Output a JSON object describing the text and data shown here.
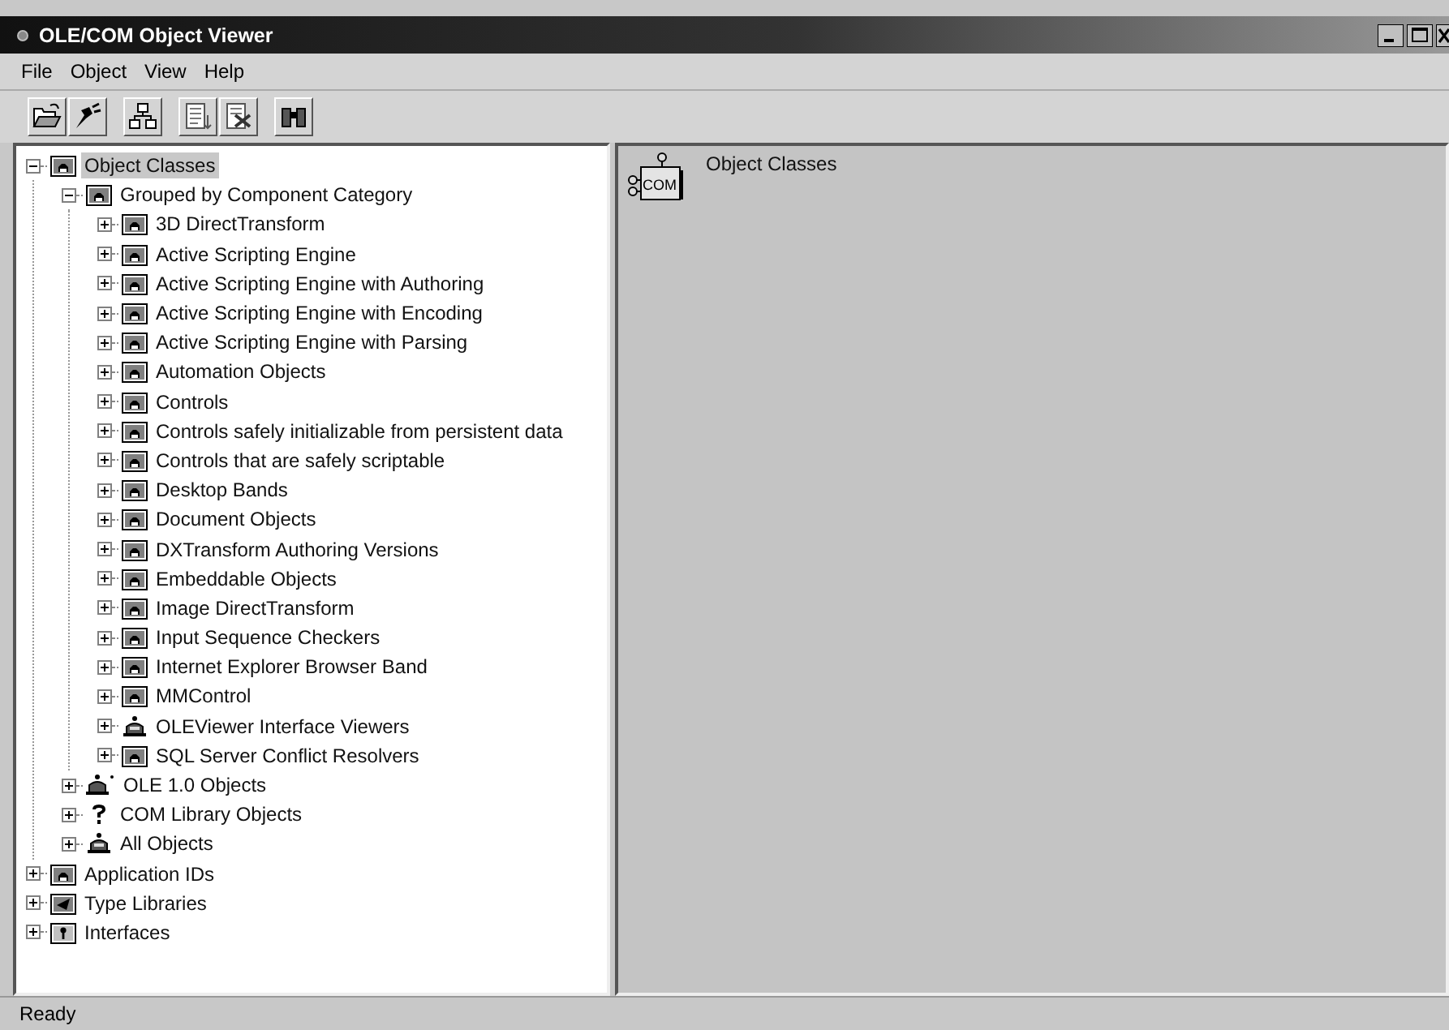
{
  "window": {
    "title": "OLE/COM Object Viewer"
  },
  "menu": [
    "File",
    "Object",
    "View",
    "Help"
  ],
  "tree": [
    {
      "label": "Object Classes",
      "kind": "folder",
      "expanded": true,
      "selected": true,
      "children": [
        {
          "label": "Grouped by Component Category",
          "kind": "folder",
          "expanded": true,
          "selected": false,
          "children": [
            {
              "label": "3D DirectTransform",
              "kind": "folder",
              "expanded": false,
              "selected": false
            },
            {
              "label": "Active Scripting Engine",
              "kind": "folder",
              "expanded": false,
              "selected": false
            },
            {
              "label": "Active Scripting Engine with Authoring",
              "kind": "folder",
              "expanded": false,
              "selected": false
            },
            {
              "label": "Active Scripting Engine with Encoding",
              "kind": "folder",
              "expanded": false,
              "selected": false
            },
            {
              "label": "Active Scripting Engine with Parsing",
              "kind": "folder",
              "expanded": false,
              "selected": false
            },
            {
              "label": "Automation Objects",
              "kind": "folder",
              "expanded": false,
              "selected": false
            },
            {
              "label": "Controls",
              "kind": "folder",
              "expanded": false,
              "selected": false
            },
            {
              "label": "Controls safely initializable from persistent data",
              "kind": "folder",
              "expanded": false,
              "selected": false
            },
            {
              "label": "Controls that are safely scriptable",
              "kind": "folder",
              "expanded": false,
              "selected": false
            },
            {
              "label": "Desktop Bands",
              "kind": "folder",
              "expanded": false,
              "selected": false
            },
            {
              "label": "Document Objects",
              "kind": "folder",
              "expanded": false,
              "selected": false
            },
            {
              "label": "DXTransform Authoring Versions",
              "kind": "folder",
              "expanded": false,
              "selected": false
            },
            {
              "label": "Embeddable Objects",
              "kind": "folder",
              "expanded": false,
              "selected": false
            },
            {
              "label": "Image DirectTransform",
              "kind": "folder",
              "expanded": false,
              "selected": false
            },
            {
              "label": "Input Sequence Checkers",
              "kind": "folder",
              "expanded": false,
              "selected": false
            },
            {
              "label": "Internet Explorer Browser Band",
              "kind": "folder",
              "expanded": false,
              "selected": false
            },
            {
              "label": "MMControl",
              "kind": "folder",
              "expanded": false,
              "selected": false
            },
            {
              "label": "OLEViewer Interface Viewers",
              "kind": "object",
              "expanded": false,
              "selected": false
            },
            {
              "label": "SQL Server Conflict Resolvers",
              "kind": "folder",
              "expanded": false,
              "selected": false
            }
          ]
        },
        {
          "label": "OLE 1.0 Objects",
          "kind": "ole1",
          "expanded": false,
          "selected": false
        },
        {
          "label": "COM Library Objects",
          "kind": "question",
          "expanded": false,
          "selected": false
        },
        {
          "label": "All Objects",
          "kind": "object",
          "expanded": false,
          "selected": false
        }
      ]
    },
    {
      "label": "Application IDs",
      "kind": "folder",
      "expanded": false,
      "selected": false
    },
    {
      "label": "Type Libraries",
      "kind": "typelib",
      "expanded": false,
      "selected": false
    },
    {
      "label": "Interfaces",
      "kind": "interface",
      "expanded": false,
      "selected": false
    }
  ],
  "detail": {
    "title": "Object Classes",
    "badge": "COM"
  },
  "status_bar": "Ready"
}
